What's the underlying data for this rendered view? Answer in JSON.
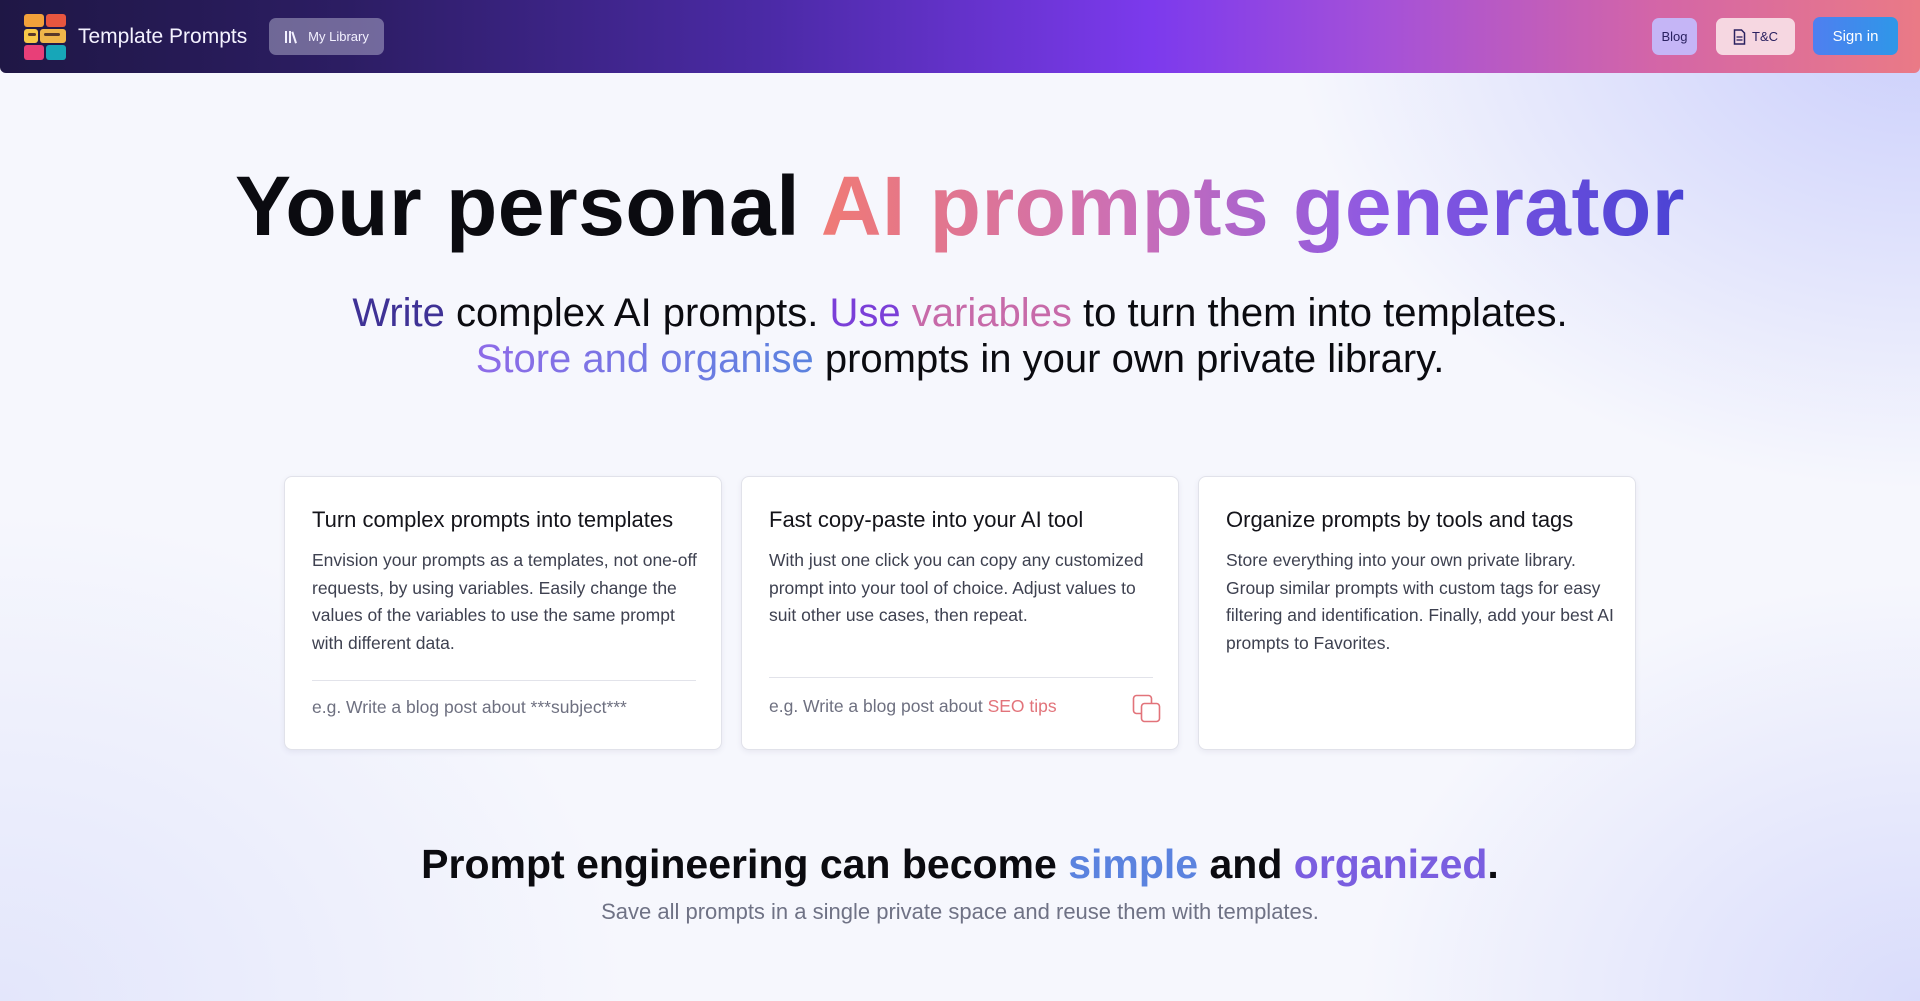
{
  "header": {
    "brand_name": "Template Prompts",
    "library_label": "My Library",
    "blog_label": "Blog",
    "tc_label": "T&C",
    "signin_label": "Sign in"
  },
  "hero": {
    "title_plain": "Your personal",
    "title_gradient": "AI prompts generator",
    "sub_write": "Write",
    "sub_part1": " complex AI prompts. ",
    "sub_use": "Use",
    "sub_variables": "variables",
    "sub_part2": " to turn them into templates.",
    "sub_store": "Store and organise",
    "sub_part3": " prompts in your own private library."
  },
  "cards": [
    {
      "title": "Turn complex prompts into templates",
      "description": "Envision your prompts as a templates, not one-off requests, by using variables. Easily change the values of the variables to use the same prompt with different data.",
      "example": "e.g. Write a blog post about ***subject***"
    },
    {
      "title": "Fast copy-paste into your AI tool",
      "description": "With just one click you can copy any customized prompt into your tool of choice. Adjust values to suit other use cases, then repeat.",
      "example_prefix": "e.g. Write a blog post about ",
      "example_highlight": "SEO tips"
    },
    {
      "title": "Organize prompts by tools and tags",
      "description": "Store everything into your own private library. Group similar prompts with custom tags for easy filtering and identification. Finally, add your best AI prompts to Favorites."
    }
  ],
  "bottom": {
    "title_part1": "Prompt engineering can become ",
    "title_simple": "simple",
    "title_and": " and ",
    "title_organized": "organized",
    "title_period": ".",
    "subtitle": "Save all prompts in a single private space and reuse them with templates."
  },
  "colors": {
    "accent_blue": "#2e97e8",
    "accent_purple": "#7c3aed",
    "accent_coral": "#e2737a"
  },
  "icons": [
    "library-icon",
    "document-icon",
    "copy-icon",
    "app-logo"
  ]
}
